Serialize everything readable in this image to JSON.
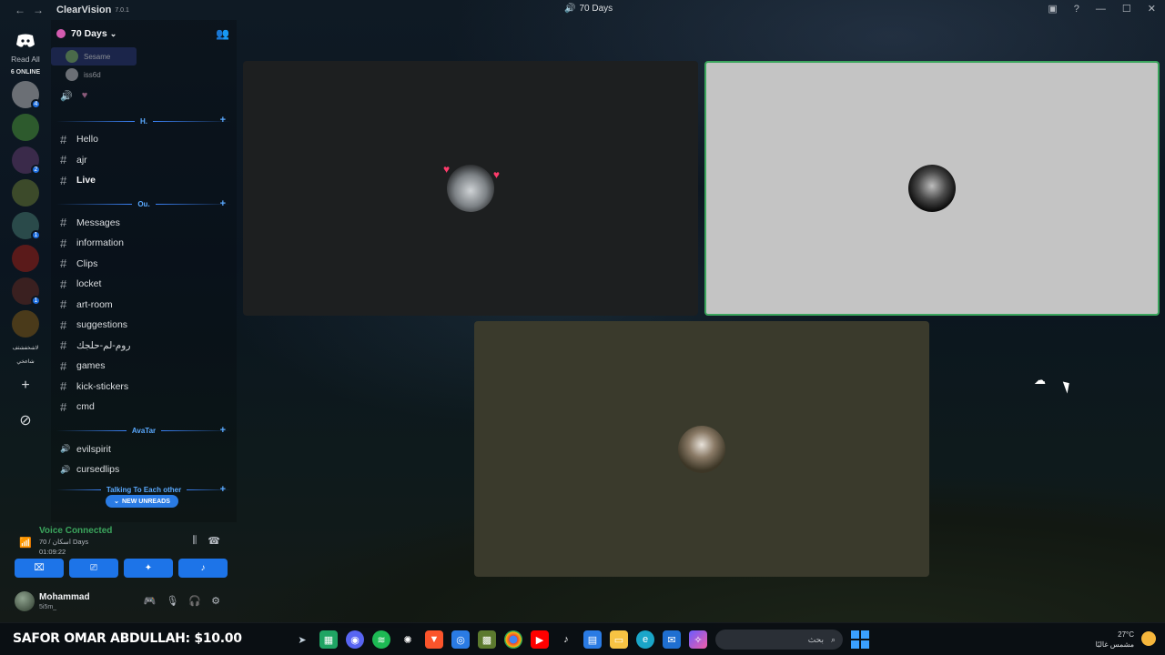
{
  "titlebar": {
    "back": "←",
    "forward": "→",
    "brand": "ClearVision",
    "version": "7.0.1",
    "channel_title": "70 Days",
    "inbox_icon": "inbox-icon",
    "help_icon": "help-icon",
    "minimize": "—",
    "maximize": "☐",
    "close": "✕"
  },
  "rail": {
    "read_all": "Read All",
    "online": "6 ONLINE",
    "servers": [
      {
        "name": "server-1",
        "color": "#6b6f75",
        "badge": "4"
      },
      {
        "name": "server-2",
        "color": "#2d5a2d",
        "badge": ""
      },
      {
        "name": "server-3",
        "color": "#3a2a4a",
        "badge": "2"
      },
      {
        "name": "server-4",
        "color": "#3c4a2a",
        "badge": ""
      },
      {
        "name": "server-5",
        "color": "#2a4a4a",
        "badge": "1"
      },
      {
        "name": "server-6",
        "color": "#5a1a1a",
        "badge": ""
      },
      {
        "name": "server-7",
        "color": "#3a2020",
        "badge": "1"
      },
      {
        "name": "server-8",
        "color": "#4a3a1a",
        "badge": ""
      }
    ],
    "text_server_1": "لاشخفشثف",
    "text_server_2": "شاعخي",
    "add_label": "+",
    "discover_label": "⊘"
  },
  "sidebar": {
    "guild_name": "70 Days",
    "voice_users": [
      {
        "name": "Sesame",
        "active": true
      },
      {
        "name": "iss6d",
        "active": false
      }
    ],
    "speaker_emoji": "🔊",
    "heart": "♥",
    "categories": [
      {
        "name": "H.",
        "channels": [
          {
            "name": "Hello",
            "bold": false
          },
          {
            "name": "ajr",
            "bold": false
          },
          {
            "name": "Live",
            "bold": true
          }
        ]
      },
      {
        "name": "Ou.",
        "channels": [
          {
            "name": "Messages",
            "bold": false
          },
          {
            "name": "information",
            "bold": false
          },
          {
            "name": "Clips",
            "bold": false
          },
          {
            "name": "locket",
            "bold": false
          },
          {
            "name": "art-room",
            "bold": false
          },
          {
            "name": "suggestions",
            "bold": false
          },
          {
            "name": "روم-لم-حلجك",
            "bold": false
          },
          {
            "name": "games",
            "bold": false
          },
          {
            "name": "kick-stickers",
            "bold": false
          },
          {
            "name": "cmd",
            "bold": false
          }
        ]
      },
      {
        "name": "AvaTar",
        "channels": [
          {
            "name": "evilspirit",
            "bold": false
          },
          {
            "name": "cursedlips",
            "bold": false
          }
        ]
      }
    ],
    "last_category": "Talking To Each other",
    "new_unreads": "NEW UNREADS"
  },
  "voice": {
    "status": "Voice Connected",
    "channel": "70 / اسكان Days",
    "elapsed": "01:09:22"
  },
  "user": {
    "name": "Mohammad",
    "status": "5i5m_"
  },
  "taskbar": {
    "donation": "SAFOR OMAR ABDULLAH: $10.00",
    "search_placeholder": "بحث",
    "temperature": "27°C",
    "weather": "مشمس غالبًا"
  }
}
